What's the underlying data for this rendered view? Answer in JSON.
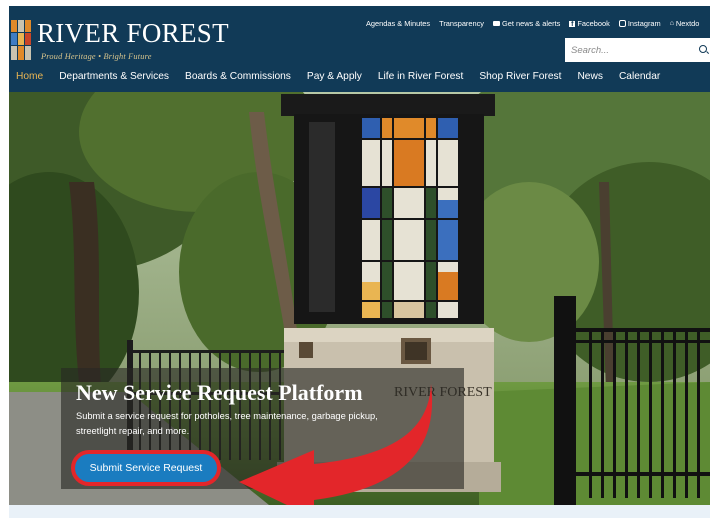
{
  "site": {
    "name": "RIVER FOREST",
    "tagline": "Proud Heritage • Bright Future"
  },
  "toplinks": [
    {
      "label": "Agendas & Minutes",
      "icon": ""
    },
    {
      "label": "Transparency",
      "icon": ""
    },
    {
      "label": "Get news & alerts",
      "icon": "mail-icon"
    },
    {
      "label": "Facebook",
      "icon": "facebook-icon"
    },
    {
      "label": "Instagram",
      "icon": "instagram-icon"
    },
    {
      "label": "Nextdo",
      "icon": "nextdoor-icon"
    }
  ],
  "search": {
    "placeholder": "Search..."
  },
  "nav": [
    {
      "label": "Home",
      "active": true
    },
    {
      "label": "Departments & Services"
    },
    {
      "label": "Boards & Commissions"
    },
    {
      "label": "Pay & Apply"
    },
    {
      "label": "Life in River Forest"
    },
    {
      "label": "Shop River Forest"
    },
    {
      "label": "News"
    },
    {
      "label": "Calendar"
    }
  ],
  "hero": {
    "title": "New Service Request Platform",
    "text": "Submit a service request for potholes, tree maintenance, garbage pickup, streetlight repair, and more.",
    "cta": "Submit Service Request",
    "monument_text": "RIVER FOREST"
  },
  "colors": {
    "header_bg": "#113a57",
    "active_nav": "#e9b552",
    "cta_bg": "#1a7cc0",
    "highlight_red": "#e3262a"
  }
}
